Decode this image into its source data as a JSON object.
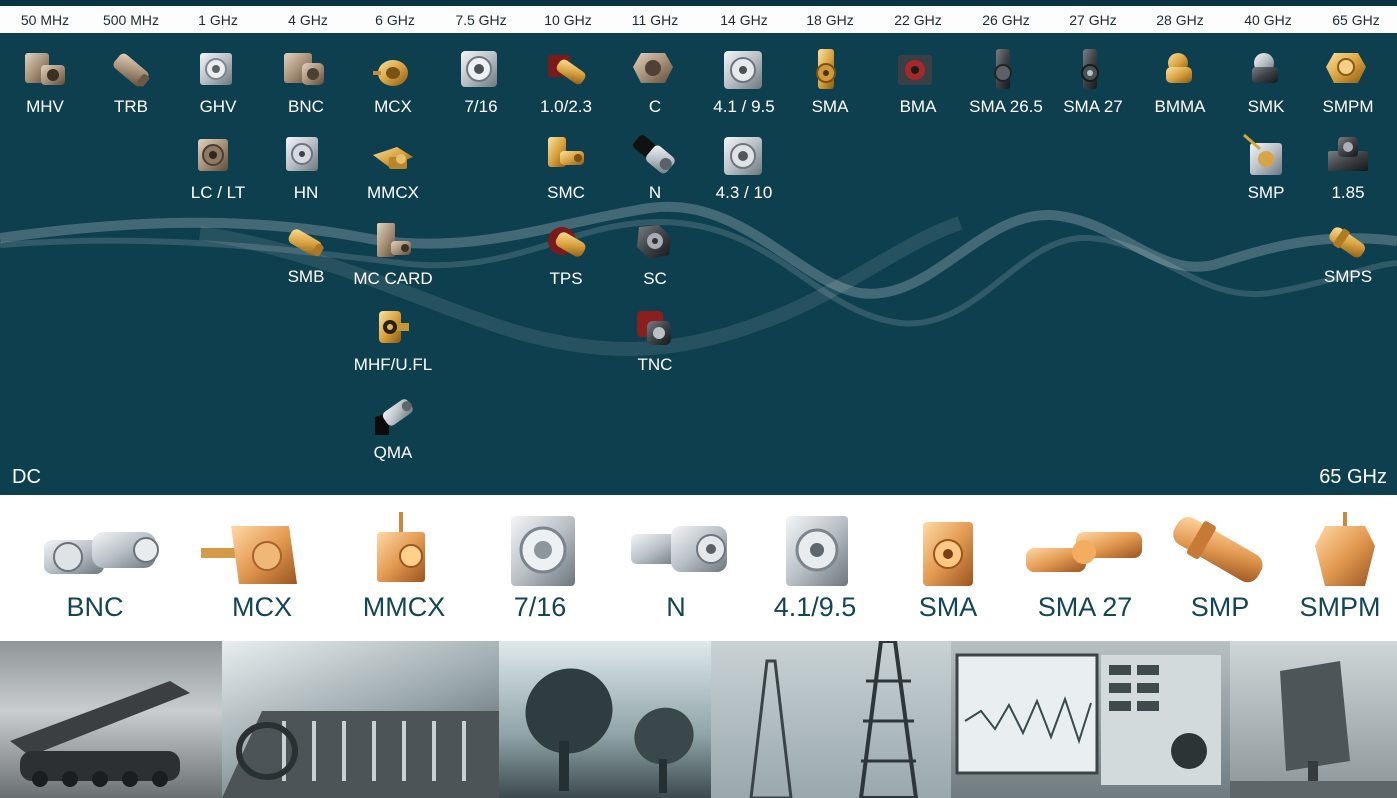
{
  "frequencies": [
    "50 MHz",
    "500 MHz",
    "1 GHz",
    "4 GHz",
    "6 GHz",
    "7.5 GHz",
    "10 GHz",
    "11 GHz",
    "14 GHz",
    "18 GHz",
    "22 GHz",
    "26 GHz",
    "27 GHz",
    "28 GHz",
    "40 GHz",
    "65 GHz"
  ],
  "range": {
    "start": "DC",
    "end": "65 GHz"
  },
  "connectors": {
    "mhv": {
      "label": "MHV",
      "icon": "mhv-connector-icon"
    },
    "trb": {
      "label": "TRB",
      "icon": "trb-connector-icon"
    },
    "ghv": {
      "label": "GHV",
      "icon": "ghv-connector-icon"
    },
    "lclt": {
      "label": "LC / LT",
      "icon": "lc-lt-connector-icon"
    },
    "bnc": {
      "label": "BNC",
      "icon": "bnc-connector-icon"
    },
    "hn": {
      "label": "HN",
      "icon": "hn-connector-icon"
    },
    "smb": {
      "label": "SMB",
      "icon": "smb-connector-icon"
    },
    "mcx": {
      "label": "MCX",
      "icon": "mcx-connector-icon"
    },
    "mmcx": {
      "label": "MMCX",
      "icon": "mmcx-connector-icon"
    },
    "mccard": {
      "label": "MC CARD",
      "icon": "mc-card-connector-icon"
    },
    "mhf": {
      "label": "MHF/U.FL",
      "icon": "mhf-connector-icon"
    },
    "qma": {
      "label": "QMA",
      "icon": "qma-connector-icon"
    },
    "s716": {
      "label": "7/16",
      "icon": "7-16-connector-icon"
    },
    "s123": {
      "label": "1.0/2.3",
      "icon": "1-0-2-3-connector-icon"
    },
    "smc": {
      "label": "SMC",
      "icon": "smc-connector-icon"
    },
    "tps": {
      "label": "TPS",
      "icon": "tps-connector-icon"
    },
    "c": {
      "label": "C",
      "icon": "c-connector-icon"
    },
    "n": {
      "label": "N",
      "icon": "n-connector-icon"
    },
    "sc": {
      "label": "SC",
      "icon": "sc-connector-icon"
    },
    "tnc": {
      "label": "TNC",
      "icon": "tnc-connector-icon"
    },
    "s4195": {
      "label": "4.1 / 9.5",
      "icon": "4-1-9-5-connector-icon"
    },
    "s4310": {
      "label": "4.3 / 10",
      "icon": "4-3-10-connector-icon"
    },
    "sma": {
      "label": "SMA",
      "icon": "sma-connector-icon"
    },
    "bma": {
      "label": "BMA",
      "icon": "bma-connector-icon"
    },
    "sma265": {
      "label": "SMA 26.5",
      "icon": "sma-26-5-connector-icon"
    },
    "sma27": {
      "label": "SMA 27",
      "icon": "sma-27-connector-icon"
    },
    "bmma": {
      "label": "BMMA",
      "icon": "bmma-connector-icon"
    },
    "smk": {
      "label": "SMK",
      "icon": "smk-connector-icon"
    },
    "smp": {
      "label": "SMP",
      "icon": "smp-connector-icon"
    },
    "smpm": {
      "label": "SMPM",
      "icon": "smpm-connector-icon"
    },
    "s185": {
      "label": "1.85",
      "icon": "1-85-connector-icon"
    },
    "smps": {
      "label": "SMPS",
      "icon": "smps-connector-icon"
    }
  },
  "featured": [
    "BNC",
    "MCX",
    "MMCX",
    "7/16",
    "N",
    "4.1/9.5",
    "SMA",
    "SMA 27",
    "SMP",
    "SMPM"
  ],
  "applications": [
    {
      "icon": "military-bridge-vehicle-photo"
    },
    {
      "icon": "audio-mixing-console-photo"
    },
    {
      "icon": "satellite-dishes-photo"
    },
    {
      "icon": "cell-towers-photo"
    },
    {
      "icon": "spectrum-analyzer-photo"
    },
    {
      "icon": "radar-antenna-photo"
    }
  ],
  "colors": {
    "panel": "#0e3f4f",
    "label_dark": "#134556",
    "gold": "#d9a441",
    "silver": "#b9c0c6"
  }
}
